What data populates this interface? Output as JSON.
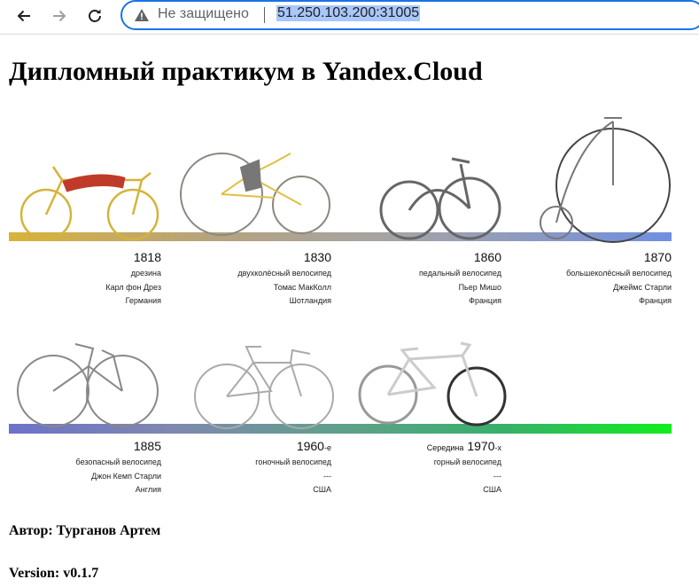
{
  "browser": {
    "security_label": "Не защищено",
    "url": "51.250.103.200:31005"
  },
  "page": {
    "heading": "Дипломный практикум в Yandex.Cloud",
    "author": "Автор: Турганов Артем",
    "version": "Version: v0.1.7"
  },
  "timeline": [
    {
      "year": "1818",
      "type": "дрезина",
      "inventor": "Карл фон Дрез",
      "country": "Германия"
    },
    {
      "year": "1830",
      "type": "двухколёсный велосипед",
      "inventor": "Томас МакКолл",
      "country": "Шотландия"
    },
    {
      "year": "1860",
      "type": "педальный велосипед",
      "inventor": "Пьер Мишо",
      "country": "Франция"
    },
    {
      "year": "1870",
      "type": "большеколёсный велосипед",
      "inventor": "Джеймс Старли",
      "country": "Франция"
    },
    {
      "year": "1885",
      "type": "безопасный велосипед",
      "inventor": "Джон Кемп Старли",
      "country": "Англия"
    },
    {
      "year": "1960",
      "year_suffix": "-е",
      "type": "гоночный велосипед",
      "inventor": "---",
      "country": "США"
    },
    {
      "prefix": "Середина",
      "year": "1970",
      "year_suffix": "-х",
      "type": "горный велосипед",
      "inventor": "---",
      "country": "США"
    }
  ]
}
